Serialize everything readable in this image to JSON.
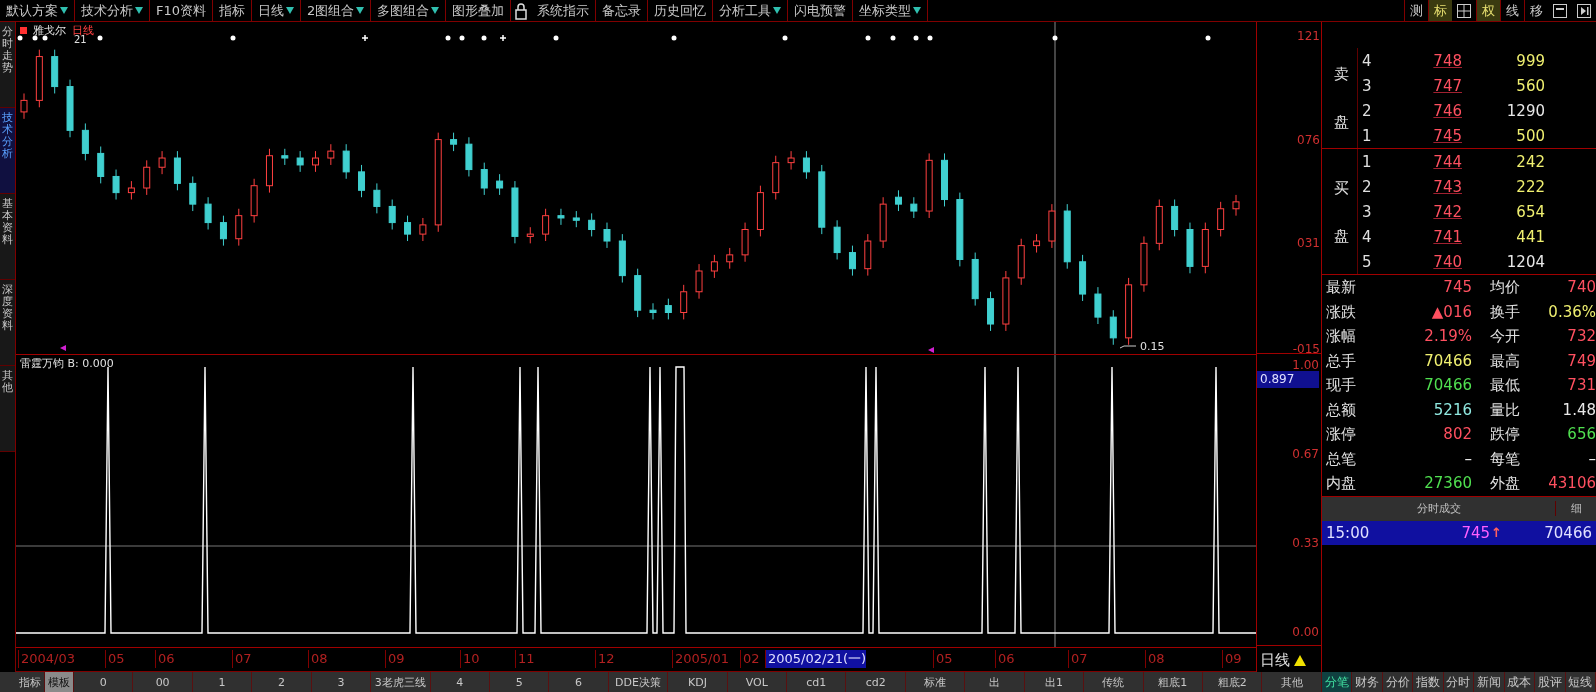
{
  "toolbar": {
    "items": [
      {
        "kind": "menu",
        "label": "默认方案",
        "dropdown": true
      },
      {
        "kind": "menu",
        "label": "技术分析",
        "dropdown": true
      },
      {
        "kind": "menu",
        "label": "F10资料",
        "dropdown": false
      },
      {
        "kind": "menu",
        "label": "指标",
        "dropdown": false
      },
      {
        "kind": "menu",
        "label": "日线",
        "dropdown": true
      },
      {
        "kind": "menu",
        "label": "2图组合",
        "dropdown": true
      },
      {
        "kind": "menu",
        "label": "多图组合",
        "dropdown": true
      },
      {
        "kind": "menu",
        "label": "图形叠加",
        "dropdown": false
      },
      {
        "kind": "lock"
      },
      {
        "kind": "menu",
        "label": "系统指示",
        "dropdown": false
      },
      {
        "kind": "menu",
        "label": "备忘录",
        "dropdown": false
      },
      {
        "kind": "menu",
        "label": "历史回忆",
        "dropdown": false
      },
      {
        "kind": "menu",
        "label": "分析工具",
        "dropdown": true
      },
      {
        "kind": "menu",
        "label": "闪电预警",
        "dropdown": false
      },
      {
        "kind": "menu",
        "label": "坐标类型",
        "dropdown": true
      }
    ],
    "tools": [
      {
        "kind": "text",
        "label": "测",
        "selected": false
      },
      {
        "kind": "text",
        "label": "标",
        "selected": true
      },
      {
        "kind": "grid"
      },
      {
        "kind": "text",
        "label": "权",
        "selected": true
      },
      {
        "kind": "text",
        "label": "线",
        "selected": false
      },
      {
        "kind": "text",
        "label": "移",
        "selected": false
      },
      {
        "kind": "window"
      },
      {
        "kind": "panel"
      }
    ]
  },
  "sidebar": {
    "tabs": [
      {
        "label": "分时走势",
        "selected": false
      },
      {
        "label": "技术分析",
        "selected": true
      },
      {
        "label": "基本资料",
        "selected": false
      },
      {
        "label": "深度资料",
        "selected": false
      },
      {
        "label": "其他",
        "selected": false
      }
    ]
  },
  "price_chart": {
    "stock_name": "雅戈尔",
    "period": "日线",
    "mark_label": "21",
    "low_label": "0.15",
    "chart_data": {
      "type": "candlestick",
      "ylim": [
        -17,
        127
      ],
      "yticks": [
        {
          "value": 121,
          "label": "121"
        },
        {
          "value": 76,
          "label": "076"
        },
        {
          "value": 31,
          "label": "031"
        },
        {
          "value": -15,
          "label": "-015"
        }
      ],
      "ohlc": [
        [
          88,
          96,
          85,
          93
        ],
        [
          93,
          115,
          90,
          112
        ],
        [
          112,
          115,
          96,
          99
        ],
        [
          99,
          102,
          77,
          80
        ],
        [
          80,
          83,
          67,
          70
        ],
        [
          70,
          73,
          57,
          60
        ],
        [
          60,
          63,
          50,
          53
        ],
        [
          53,
          58,
          50,
          55
        ],
        [
          55,
          67,
          52,
          64
        ],
        [
          64,
          71,
          61,
          68
        ],
        [
          68,
          71,
          54,
          57
        ],
        [
          57,
          60,
          45,
          48
        ],
        [
          48,
          51,
          37,
          40
        ],
        [
          40,
          43,
          30,
          33
        ],
        [
          33,
          46,
          30,
          43
        ],
        [
          43,
          59,
          40,
          56
        ],
        [
          56,
          72,
          53,
          69
        ],
        [
          69,
          72,
          65,
          68
        ],
        [
          68,
          71,
          62,
          65
        ],
        [
          65,
          71,
          62,
          68
        ],
        [
          68,
          74,
          65,
          71
        ],
        [
          71,
          74,
          59,
          62
        ],
        [
          62,
          65,
          51,
          54
        ],
        [
          54,
          57,
          44,
          47
        ],
        [
          47,
          50,
          37,
          40
        ],
        [
          40,
          43,
          32,
          35
        ],
        [
          35,
          42,
          32,
          39
        ],
        [
          39,
          79,
          36,
          76
        ],
        [
          76,
          79,
          71,
          74
        ],
        [
          74,
          77,
          60,
          63
        ],
        [
          63,
          66,
          52,
          55
        ],
        [
          58,
          61,
          52,
          55
        ],
        [
          55,
          58,
          31,
          34
        ],
        [
          34,
          38,
          31,
          35
        ],
        [
          35,
          46,
          32,
          43
        ],
        [
          43,
          46,
          39,
          42
        ],
        [
          42,
          45,
          38,
          41
        ],
        [
          41,
          44,
          34,
          37
        ],
        [
          37,
          40,
          29,
          32
        ],
        [
          32,
          35,
          14,
          17
        ],
        [
          17,
          20,
          -1,
          2
        ],
        [
          2,
          5,
          -2,
          1
        ],
        [
          4,
          7,
          -2,
          1
        ],
        [
          1,
          13,
          -2,
          10
        ],
        [
          10,
          22,
          7,
          19
        ],
        [
          19,
          26,
          16,
          23
        ],
        [
          23,
          29,
          20,
          26
        ],
        [
          26,
          40,
          23,
          37
        ],
        [
          37,
          56,
          34,
          53
        ],
        [
          53,
          69,
          50,
          66
        ],
        [
          66,
          71,
          63,
          68
        ],
        [
          68,
          71,
          59,
          62
        ],
        [
          62,
          65,
          35,
          38
        ],
        [
          38,
          41,
          24,
          27
        ],
        [
          27,
          30,
          17,
          20
        ],
        [
          20,
          35,
          17,
          32
        ],
        [
          32,
          51,
          29,
          48
        ],
        [
          51,
          54,
          45,
          48
        ],
        [
          48,
          51,
          42,
          45
        ],
        [
          45,
          70,
          42,
          67
        ],
        [
          67,
          70,
          47,
          50
        ],
        [
          50,
          53,
          21,
          24
        ],
        [
          24,
          27,
          4,
          7
        ],
        [
          7,
          10,
          -7,
          -4
        ],
        [
          -4,
          19,
          -7,
          16
        ],
        [
          16,
          33,
          13,
          30
        ],
        [
          30,
          35,
          27,
          32
        ],
        [
          32,
          48,
          29,
          45
        ],
        [
          45,
          48,
          20,
          23
        ],
        [
          23,
          26,
          6,
          9
        ],
        [
          9,
          12,
          -4,
          -1
        ],
        [
          -1,
          2,
          -13,
          -10
        ],
        [
          -10,
          16,
          -13,
          13
        ],
        [
          13,
          34,
          10,
          31
        ],
        [
          31,
          50,
          28,
          47
        ],
        [
          47,
          50,
          34,
          37
        ],
        [
          37,
          40,
          18,
          21
        ],
        [
          21,
          40,
          18,
          37
        ],
        [
          37,
          49,
          34,
          46
        ],
        [
          46,
          52,
          43,
          49
        ]
      ]
    }
  },
  "indicator": {
    "title": "雷霆万钧 B: 0.000",
    "axis_labels": [
      "1.00",
      "0.67",
      "0.33",
      "0.00"
    ],
    "current_value": "0.897"
  },
  "dates": [
    {
      "label": "2004/03",
      "selected": false
    },
    {
      "label": "05",
      "selected": false
    },
    {
      "label": "06",
      "selected": false
    },
    {
      "label": "07",
      "selected": false
    },
    {
      "label": "08",
      "selected": false
    },
    {
      "label": "09",
      "selected": false
    },
    {
      "label": "10",
      "selected": false
    },
    {
      "label": "11",
      "selected": false
    },
    {
      "label": "12",
      "selected": false
    },
    {
      "label": "2005/01",
      "selected": false
    },
    {
      "label": "02",
      "selected": false
    },
    {
      "label": "2005/02/21(一)",
      "selected": true
    },
    {
      "label": "05",
      "selected": false
    },
    {
      "label": "06",
      "selected": false
    },
    {
      "label": "07",
      "selected": false
    },
    {
      "label": "08",
      "selected": false
    },
    {
      "label": "09",
      "selected": false
    }
  ],
  "period_switch": "日线",
  "bottom_tabs": [
    {
      "label": "指标",
      "selected": false
    },
    {
      "label": "模板",
      "selected": true
    },
    {
      "label": "0",
      "selected": false
    },
    {
      "label": "00",
      "selected": false
    },
    {
      "label": "1",
      "selected": false
    },
    {
      "label": "2",
      "selected": false
    },
    {
      "label": "3",
      "selected": false
    },
    {
      "label": "3老虎三线",
      "selected": false
    },
    {
      "label": "4",
      "selected": false
    },
    {
      "label": "5",
      "selected": false
    },
    {
      "label": "6",
      "selected": false
    },
    {
      "label": "DDE决策",
      "selected": false
    },
    {
      "label": "KDJ",
      "selected": false
    },
    {
      "label": "VOL",
      "selected": false
    },
    {
      "label": "cd1",
      "selected": false
    },
    {
      "label": "cd2",
      "selected": false
    },
    {
      "label": "标准",
      "selected": false
    },
    {
      "label": "出",
      "selected": false
    },
    {
      "label": "出1",
      "selected": false
    },
    {
      "label": "传统",
      "selected": false
    },
    {
      "label": "粗底1",
      "selected": false
    },
    {
      "label": "粗底2",
      "selected": false
    },
    {
      "label": "其他",
      "selected": false
    }
  ],
  "order_book": {
    "sell": {
      "label": "卖盘",
      "rows": [
        {
          "rank": "4",
          "price": "748",
          "volume": "999",
          "color": "#f0f070"
        },
        {
          "rank": "3",
          "price": "747",
          "volume": "560",
          "color": "#f0f070"
        },
        {
          "rank": "2",
          "price": "746",
          "volume": "1290",
          "color": "#e8e8e8"
        },
        {
          "rank": "1",
          "price": "745",
          "volume": "500",
          "color": "#f0f070"
        }
      ]
    },
    "buy": {
      "label": "买盘",
      "rows": [
        {
          "rank": "1",
          "price": "744",
          "volume": "242",
          "color": "#f0f070"
        },
        {
          "rank": "2",
          "price": "743",
          "volume": "222",
          "color": "#f0f070"
        },
        {
          "rank": "3",
          "price": "742",
          "volume": "654",
          "color": "#f0f070"
        },
        {
          "rank": "4",
          "price": "741",
          "volume": "441",
          "color": "#f0f070"
        },
        {
          "rank": "5",
          "price": "740",
          "volume": "1204",
          "color": "#e8e8e8"
        }
      ]
    }
  },
  "stats": [
    {
      "label": "最新",
      "value": "745",
      "color": "#ff5060"
    },
    {
      "label": "均价",
      "value": "740",
      "color": "#ff5060"
    },
    {
      "label": "涨跌",
      "value": "▲016",
      "color": "#ff5060"
    },
    {
      "label": "换手",
      "value": "0.36%",
      "color": "#f0f070"
    },
    {
      "label": "涨幅",
      "value": "2.19%",
      "color": "#ff5060"
    },
    {
      "label": "今开",
      "value": "732",
      "color": "#ff5060"
    },
    {
      "label": "总手",
      "value": "70466",
      "color": "#f0f070"
    },
    {
      "label": "最高",
      "value": "749",
      "color": "#ff5060"
    },
    {
      "label": "现手",
      "value": "70466",
      "color": "#50e050"
    },
    {
      "label": "最低",
      "value": "731",
      "color": "#ff5060"
    },
    {
      "label": "总额",
      "value": "5216",
      "color": "#90e8e0"
    },
    {
      "label": "量比",
      "value": "1.48",
      "color": "#e8e8e8"
    },
    {
      "label": "涨停",
      "value": "802",
      "color": "#ff5060"
    },
    {
      "label": "跌停",
      "value": "656",
      "color": "#50e050"
    },
    {
      "label": "总笔",
      "value": "–",
      "color": "#e8e8e8"
    },
    {
      "label": "每笔",
      "value": "–",
      "color": "#e8e8e8"
    },
    {
      "label": "内盘",
      "value": "27360",
      "color": "#50e050"
    },
    {
      "label": "外盘",
      "value": "43106",
      "color": "#ff5060"
    }
  ],
  "ticks": {
    "header": "分时成交",
    "header_right": "细",
    "rows": [
      {
        "time": "15:00",
        "price": "745",
        "arrow": "↑",
        "volume": "70466",
        "selected": true
      }
    ]
  },
  "panel_tabs": [
    {
      "label": "分笔",
      "selected": true
    },
    {
      "label": "财务",
      "selected": false
    },
    {
      "label": "分价",
      "selected": false
    },
    {
      "label": "指数",
      "selected": false
    },
    {
      "label": "分时",
      "selected": false
    },
    {
      "label": "新闻",
      "selected": false
    },
    {
      "label": "成本",
      "selected": false
    },
    {
      "label": "股评",
      "selected": false
    },
    {
      "label": "短线",
      "selected": false
    }
  ]
}
